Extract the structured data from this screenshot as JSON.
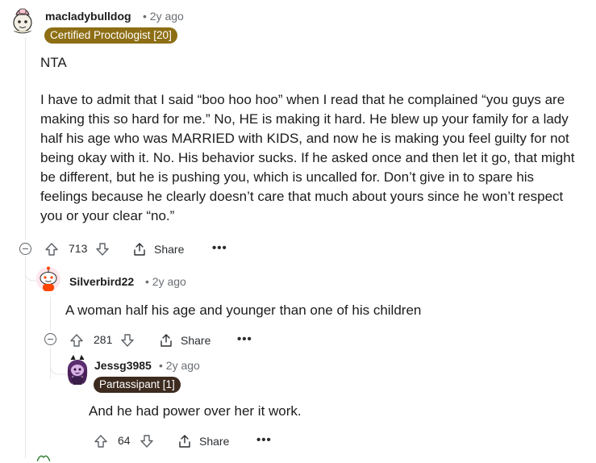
{
  "comment1": {
    "username": "macladybulldog",
    "time": "• 2y ago",
    "flair": "Certified Proctologist [20]",
    "flair_color": "#8d6e14",
    "body_p1": "NTA",
    "body_p2": "I have to admit that I said “boo hoo hoo” when I read that he complained “you guys are making this so hard for me.” No, HE is making it hard. He blew up your family for a lady half his age who was MARRIED with KIDS, and now he is making you feel guilty for not being okay with it. No. His behavior sucks. If he asked once and then let it go, that might be different, but he is pushing you, which is uncalled for. Don’t give in to spare his feelings because he clearly doesn’t care that much about yours since he won’t respect you or your clear “no.”",
    "votes": "713",
    "share_label": "Share",
    "more_label": "•••"
  },
  "comment2": {
    "username": "Silverbird22",
    "time": "• 2y ago",
    "body": "A woman half his age and younger than one of his children",
    "votes": "281",
    "share_label": "Share",
    "more_label": "•••"
  },
  "comment3": {
    "username": "Jessg3985",
    "time": "• 2y ago",
    "flair": "Partassipant [1]",
    "flair_color": "#3d2b1f",
    "body": "And he had power over her it work.",
    "votes": "64",
    "share_label": "Share",
    "more_label": "•••"
  }
}
